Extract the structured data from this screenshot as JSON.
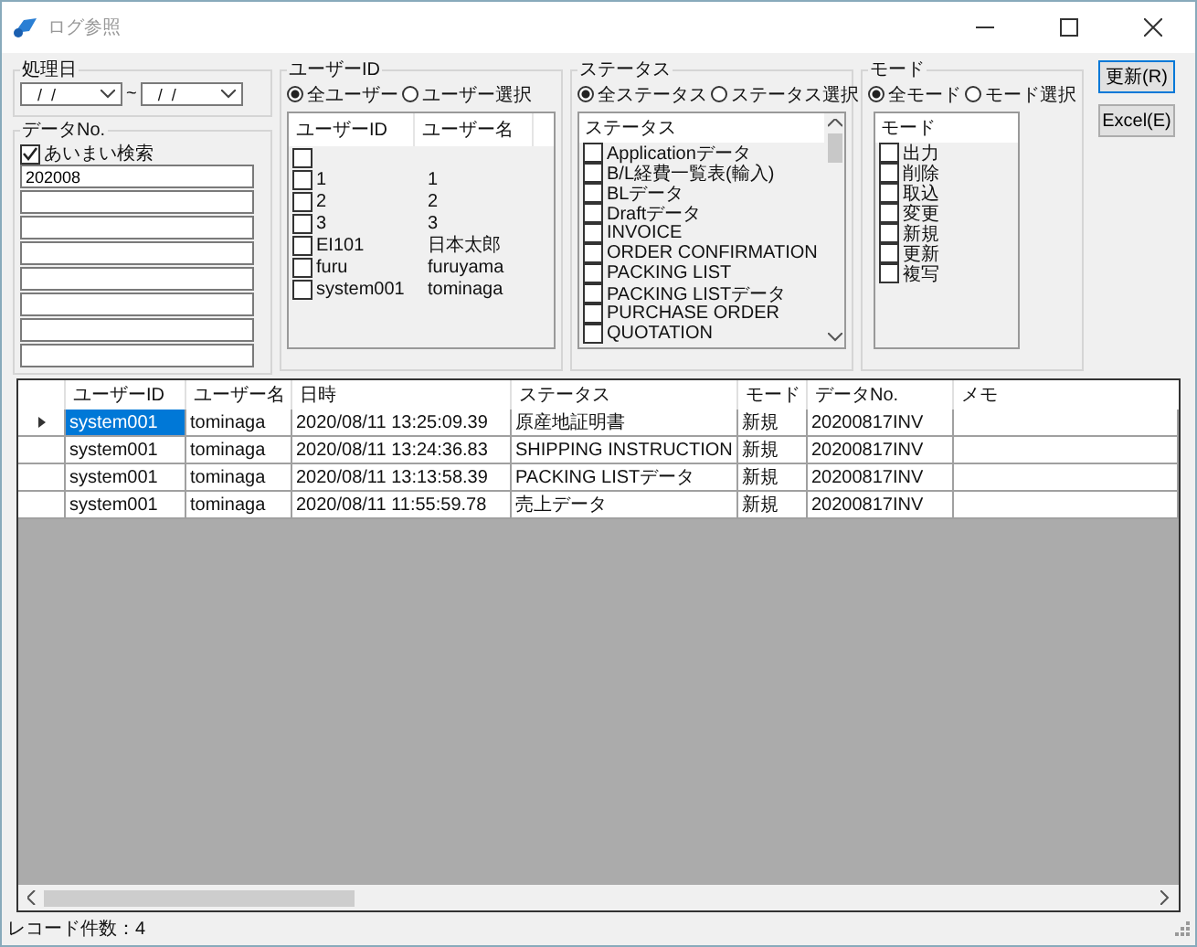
{
  "window": {
    "title": "ログ参照"
  },
  "date_range": {
    "label": "処理日",
    "from": " /  / ",
    "to": " /  / ",
    "separator": "~"
  },
  "data_no": {
    "label": "データNo.",
    "fuzzy": {
      "label": "あいまい検索",
      "checked": true
    },
    "fields": [
      {
        "kind": "text",
        "value": "202008"
      },
      {
        "kind": "text"
      },
      {
        "kind": "text"
      },
      {
        "kind": "text"
      },
      {
        "kind": "text"
      },
      {
        "kind": "text"
      },
      {
        "kind": "text"
      },
      {
        "kind": "text"
      }
    ]
  },
  "user_group": {
    "label": "ユーザーID",
    "radios": [
      {
        "label": "全ユーザー",
        "selected": true
      },
      {
        "label": "ユーザー選択",
        "selected": false
      }
    ],
    "columns": [
      "ユーザーID",
      "ユーザー名"
    ],
    "rows": [
      {
        "checked": false
      },
      {
        "id": "1",
        "name": "1",
        "checked": false
      },
      {
        "id": "2",
        "name": "2",
        "checked": false
      },
      {
        "id": "3",
        "name": "3",
        "checked": false
      },
      {
        "id": "EI101",
        "name": "日本太郎",
        "checked": false
      },
      {
        "id": "furu",
        "name": "furuyama",
        "checked": false
      },
      {
        "id": "system001",
        "name": "tominaga",
        "checked": false
      }
    ]
  },
  "status_group": {
    "label": "ステータス",
    "radios": [
      {
        "label": "全ステータス",
        "selected": true
      },
      {
        "label": "ステータス選択",
        "selected": false
      }
    ],
    "header": "ステータス",
    "items": [
      {
        "label": "Applicationデータ",
        "checked": false
      },
      {
        "label": "B/L経費一覧表(輸入)",
        "checked": false
      },
      {
        "label": "BLデータ",
        "checked": false
      },
      {
        "label": "Draftデータ",
        "checked": false
      },
      {
        "label": "INVOICE",
        "checked": false
      },
      {
        "label": "ORDER CONFIRMATION",
        "checked": false
      },
      {
        "label": "PACKING LIST",
        "checked": false
      },
      {
        "label": "PACKING LISTデータ",
        "checked": false
      },
      {
        "label": "PURCHASE ORDER",
        "checked": false
      },
      {
        "label": "QUOTATION",
        "checked": false
      }
    ]
  },
  "mode_group": {
    "label": "モード",
    "radios": [
      {
        "label": "全モード",
        "selected": true
      },
      {
        "label": "モード選択",
        "selected": false
      }
    ],
    "header": "モード",
    "items": [
      {
        "label": "出力",
        "checked": false
      },
      {
        "label": "削除",
        "checked": false
      },
      {
        "label": "取込",
        "checked": false
      },
      {
        "label": "変更",
        "checked": false
      },
      {
        "label": "新規",
        "checked": false
      },
      {
        "label": "更新",
        "checked": false
      },
      {
        "label": "複写",
        "checked": false
      }
    ]
  },
  "buttons": [
    {
      "label": "更新(R)",
      "selected": true
    },
    {
      "label": "Excel(E)",
      "selected": false
    }
  ],
  "grid": {
    "columns": [
      "ユーザーID",
      "ユーザー名",
      "日時",
      "ステータス",
      "モード",
      "データNo.",
      "メモ"
    ],
    "rows": [
      {
        "current": true,
        "cells": [
          "system001",
          "tominaga",
          "2020/08/11 13:25:09.39",
          "原産地証明書",
          "新規",
          "20200817INV"
        ]
      },
      {
        "current": false,
        "cells": [
          "system001",
          "tominaga",
          "2020/08/11 13:24:36.83",
          "SHIPPING INSTRUCTION",
          "新規",
          "20200817INV"
        ]
      },
      {
        "current": false,
        "cells": [
          "system001",
          "tominaga",
          "2020/08/11 13:13:58.39",
          "PACKING LISTデータ",
          "新規",
          "20200817INV"
        ]
      },
      {
        "current": false,
        "cells": [
          "system001",
          "tominaga",
          "2020/08/11 11:55:59.78",
          "売上データ",
          "新規",
          "20200817INV"
        ]
      }
    ]
  },
  "status_bar": {
    "text": "レコード件数：4"
  }
}
